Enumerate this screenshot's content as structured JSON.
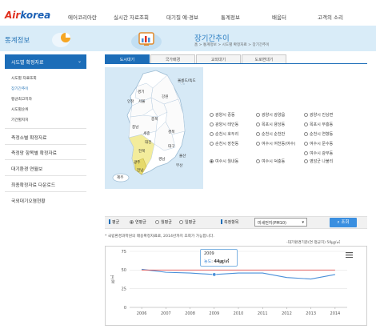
{
  "header": {
    "logo_air": "Air",
    "logo_korea": "korea",
    "nav": [
      "에어코리아란",
      "실시간 자료조회",
      "대기질 예·경보",
      "통계정보",
      "배움터",
      "고객의 소리"
    ]
  },
  "sidebar": {
    "title": "통계정보",
    "active_section": "시도별 확정자료",
    "sub_items": [
      "시도별 자료조회",
      "장기간추이",
      "평균최고지자",
      "시도별순위",
      "기간별지지"
    ],
    "highlighted_sub": 1,
    "main_items": [
      "측정소별 확정자료",
      "측정망 항목별 확정자료",
      "대기환경 연월보",
      "최종확정자료 다운로드",
      "국외대기오염현황"
    ]
  },
  "page": {
    "title": "장기간추이",
    "breadcrumb": "홈 > 통계정보 > 시도별 확정자료 > 장기간추이"
  },
  "tabs": [
    "도시대기",
    "국가배경",
    "교외대기",
    "도로변대기"
  ],
  "active_tab": 0,
  "map": {
    "regions": [
      "울릉도/독도",
      "경기",
      "인천",
      "서울",
      "강원",
      "충북",
      "충남",
      "세종",
      "대전",
      "경북",
      "대구",
      "전북",
      "울산",
      "부산",
      "경남",
      "광주",
      "전남",
      "제주"
    ]
  },
  "options": {
    "rows": [
      [
        "광양시 중동",
        "광양시 광양읍",
        "광양시 진상면"
      ],
      [
        "광양시 태인동",
        "목포시 용당동",
        "목포시 부흥동"
      ],
      [
        "순천시 호두리",
        "순천시 순천만",
        "순천시 연향동"
      ],
      [
        "순천시 장천동",
        "여수시 여천동(여수)",
        "여수시 문수동"
      ],
      [
        "",
        "",
        "여수시 광무동"
      ],
      [
        "여수시 월내동",
        "여수시 덕충동",
        "영암군 나불리"
      ]
    ],
    "selected": [
      5,
      0
    ]
  },
  "controls": {
    "type_label": "평균",
    "radio_options": [
      "연평균",
      "월평균",
      "일평균"
    ],
    "selected_radio": 0,
    "pollutant_label": "측정항목",
    "pollutant_value": "미세먼지(PM10)",
    "search_label": "조회"
  },
  "note": "* 국립환경과학원의 매용확정자료로, 2014년까지 조회가 가능합니다.",
  "unit": "-대기환경기준(연 평균치) 50㎍/㎥",
  "tooltip": {
    "year": "2009",
    "label": "농도",
    "value": "44㎍/㎥"
  },
  "colors": {
    "brand_blue": "#1c6db8",
    "accent_red": "#e0301e",
    "line_blue": "#4a90d9",
    "standard_red": "#e05050",
    "panel_bg": "#d6e9f6"
  },
  "chart_data": {
    "type": "line",
    "x": [
      "2006",
      "2007",
      "2008",
      "2009",
      "2010",
      "2011",
      "2012",
      "2013",
      "2014"
    ],
    "series": [
      {
        "name": "농도",
        "values": [
          51,
          47,
          46,
          44,
          46,
          46,
          40,
          38,
          44
        ]
      },
      {
        "name": "-대기환경기준(연 평균치) 50㎍/㎥",
        "values": [
          50,
          50,
          50,
          50,
          50,
          50,
          50,
          50,
          50
        ]
      }
    ],
    "yticks": [
      0,
      25,
      50,
      75
    ],
    "ylim": [
      0,
      75
    ],
    "ylabel": "㎍/㎥",
    "grid": true
  }
}
